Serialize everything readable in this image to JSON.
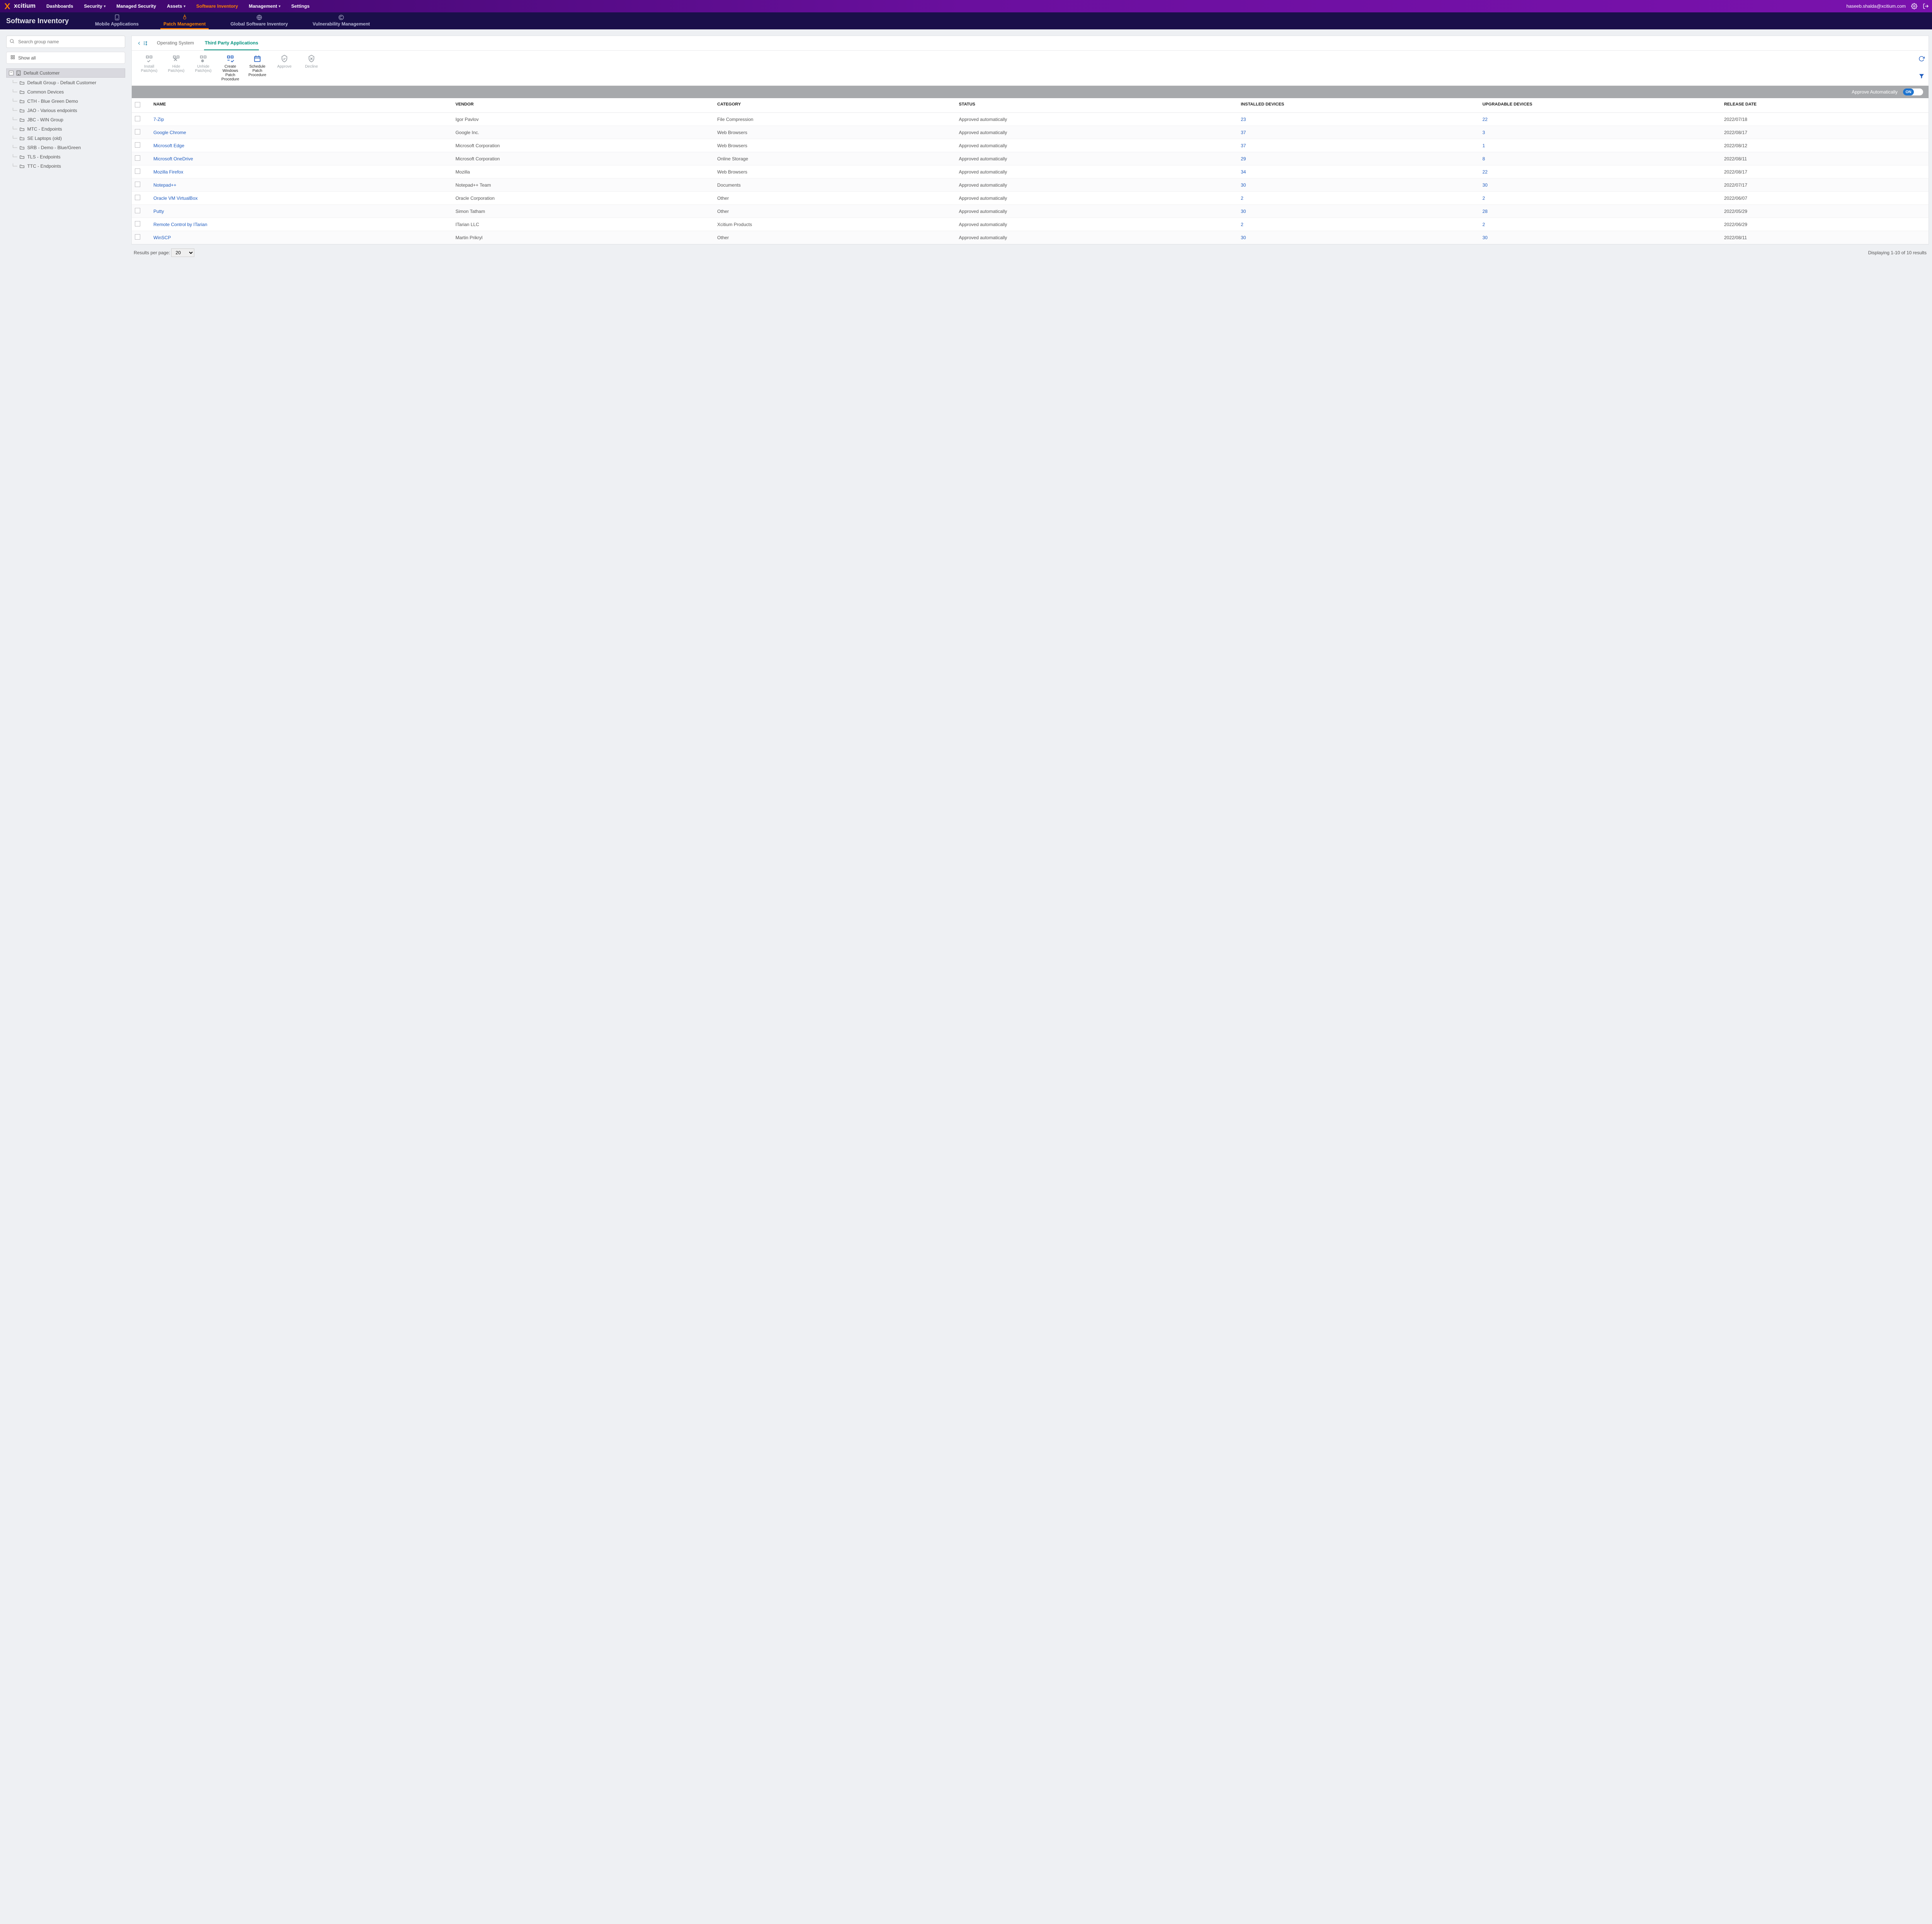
{
  "brand": "xcitium",
  "user_email": "haseeb.shalda@xcitium.com",
  "mainnav": [
    {
      "label": "Dashboards"
    },
    {
      "label": "Security",
      "chev": true
    },
    {
      "label": "Managed Security"
    },
    {
      "label": "Assets",
      "chev": true
    },
    {
      "label": "Software Inventory",
      "active": true
    },
    {
      "label": "Management",
      "chev": true
    },
    {
      "label": "Settings"
    }
  ],
  "subnav_title": "Software Inventory",
  "subnav_tabs": [
    {
      "label": "Mobile Applications"
    },
    {
      "label": "Patch Management",
      "active": true
    },
    {
      "label": "Global Software Inventory"
    },
    {
      "label": "Vulnerability Management"
    }
  ],
  "sidebar": {
    "search_placeholder": "Search group name",
    "show_all": "Show all",
    "root": "Default Customer",
    "items": [
      "Default Group - Default Customer",
      "Common Devices",
      "CTH - Blue Green Demo",
      "JAO - Various endpoints",
      "JBC - WIN Group",
      "MTC - Endpoints",
      "SE Laptops (old)",
      "SRB - Demo - Blue/Green",
      "TLS - Endpoints",
      "TTC - Endpoints"
    ]
  },
  "panel_tabs": [
    {
      "label": "Operating System"
    },
    {
      "label": "Third Party Applications",
      "active": true
    }
  ],
  "tools": [
    {
      "label": "Install Patch(es)"
    },
    {
      "label": "Hide Patch(es)"
    },
    {
      "label": "Unhide Patch(es)"
    },
    {
      "label": "Create Windows Patch Procedure",
      "active": true
    },
    {
      "label": "Schedule Patch Procedure",
      "active": true
    },
    {
      "label": "Approve"
    },
    {
      "label": "Decline"
    }
  ],
  "approve": {
    "label": "Approve Automatically",
    "state": "ON"
  },
  "columns": [
    "NAME",
    "VENDOR",
    "CATEGORY",
    "STATUS",
    "INSTALLED DEVICES",
    "UPGRADABLE DEVICES",
    "RELEASE DATE"
  ],
  "rows": [
    {
      "name": "7-Zip",
      "vendor": "Igor Pavlov",
      "category": "File Compression",
      "status": "Approved automatically",
      "installed": "23",
      "upgradable": "22",
      "date": "2022/07/18"
    },
    {
      "name": "Google Chrome",
      "vendor": "Google Inc.",
      "category": "Web Browsers",
      "status": "Approved automatically",
      "installed": "37",
      "upgradable": "3",
      "date": "2022/08/17"
    },
    {
      "name": "Microsoft Edge",
      "vendor": "Microsoft Corporation",
      "category": "Web Browsers",
      "status": "Approved automatically",
      "installed": "37",
      "upgradable": "1",
      "date": "2022/08/12"
    },
    {
      "name": "Microsoft OneDrive",
      "vendor": "Microsoft Corporation",
      "category": "Online Storage",
      "status": "Approved automatically",
      "installed": "29",
      "upgradable": "8",
      "date": "2022/08/11"
    },
    {
      "name": "Mozilla Firefox",
      "vendor": "Mozilla",
      "category": "Web Browsers",
      "status": "Approved automatically",
      "installed": "34",
      "upgradable": "22",
      "date": "2022/08/17"
    },
    {
      "name": "Notepad++",
      "vendor": "Notepad++ Team",
      "category": "Documents",
      "status": "Approved automatically",
      "installed": "30",
      "upgradable": "30",
      "date": "2022/07/17"
    },
    {
      "name": "Oracle VM VirtualBox",
      "vendor": "Oracle Corporation",
      "category": "Other",
      "status": "Approved automatically",
      "installed": "2",
      "upgradable": "2",
      "date": "2022/06/07"
    },
    {
      "name": "Putty",
      "vendor": "Simon Tatham",
      "category": "Other",
      "status": "Approved automatically",
      "installed": "30",
      "upgradable": "28",
      "date": "2022/05/29"
    },
    {
      "name": "Remote Control by ITarian",
      "vendor": "ITarian LLC",
      "category": "Xcitium Products",
      "status": "Approved automatically",
      "installed": "2",
      "upgradable": "2",
      "date": "2022/06/29"
    },
    {
      "name": "WinSCP",
      "vendor": "Martin Prikryl",
      "category": "Other",
      "status": "Approved automatically",
      "installed": "30",
      "upgradable": "30",
      "date": "2022/08/11"
    }
  ],
  "pager": {
    "label": "Results per page:",
    "value": "20",
    "summary": "Displaying 1-10 of 10 results"
  }
}
